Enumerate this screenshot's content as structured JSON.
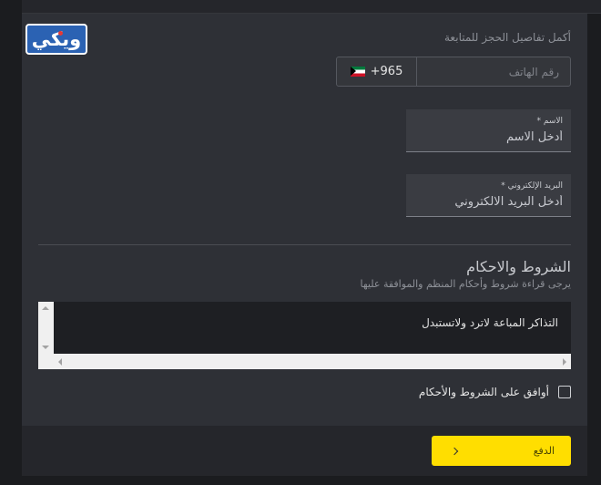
{
  "logo": {
    "text": "ويكي"
  },
  "form": {
    "section_title": "أكمل تفاصيل الحجز للمتابعة",
    "phone": {
      "country_code": "+965",
      "flag": "kuwait-flag-icon",
      "placeholder": "رقم الهاتف"
    },
    "name": {
      "label": "الاسم *",
      "placeholder": "أدخل الاسم"
    },
    "email": {
      "label": "البريد الإلكتروني *",
      "placeholder": "أدخل البريد الالكتروني"
    }
  },
  "terms": {
    "title": "الشروط والاحكام",
    "subtitle": "يرجى قراءة شروط وأحكام المنظم والموافقة عليها",
    "content": "التذاكر المباعة لاترد ولاتستبدل",
    "agree_label": "أوافق على الشروط والأحكام"
  },
  "pay_button": {
    "label": "الدفع"
  },
  "colors": {
    "accent": "#ffde00",
    "panel": "#2e3036",
    "background": "#1b1c1f",
    "logo": "#2b62b3"
  }
}
